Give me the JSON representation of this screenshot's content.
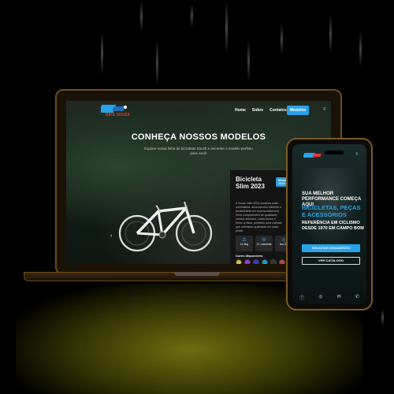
{
  "laptop": {
    "brand_text": "BIKE SOUZA",
    "nav": {
      "links": [
        "Home",
        "Sobre",
        "Contatos"
      ],
      "cta": "Modelos"
    },
    "hero": {
      "title": "CONHEÇA NOSSOS MODELOS",
      "subtitle": "Explore nossa linha de bicicletas Souzh e encontre o modelo perfeito para você!"
    },
    "card": {
      "title": "Bicicleta Slim 2023",
      "badge": "Modelos de 2023",
      "description": "A Souzh Slim 2023 combina estilo minimalista, desempenho eficiente e durabilidade em uma bicicleta leve. Seus componentes de qualidade, câmbio shimano, rodas firmes e freios a disco, perfeitos para ciclistas que valorizam qualidade em cada pedal.",
      "specs": [
        {
          "icon": "weight-icon",
          "value": "11,5kg"
        },
        {
          "icon": "gear-icon",
          "value": "21 marchas"
        },
        {
          "icon": "wheel-icon",
          "value": "Aro 29"
        }
      ],
      "colors_label": "Cores disponíveis",
      "colors": [
        "#e9c24a",
        "#a33bd6",
        "#3a3ad0",
        "#1aa7d6",
        "#333333",
        "#c44",
        "#2b8ed6",
        "#6a6a6a",
        "#e64ab4",
        "#e0e0e0"
      ]
    }
  },
  "phone": {
    "hero": {
      "line1": "SUA MELHOR PERFORMANCE COMEÇA AQUI",
      "line2": "BICICLETAS, PEÇAS E ACESSÓRIOS",
      "line3": "REFERÊNCIA EM CICLISMO DESDE 1970 EM CAMPO BOM"
    },
    "buttons": {
      "primary": "SOLICITAR ORÇAMENTO",
      "secondary": "VER CATÁLOGO"
    },
    "footer_icons": [
      "facebook-icon",
      "instagram-icon",
      "email-icon",
      "whatsapp-icon"
    ]
  },
  "colors": {
    "accent": "#29a3e8",
    "brand_red": "#e53935"
  }
}
